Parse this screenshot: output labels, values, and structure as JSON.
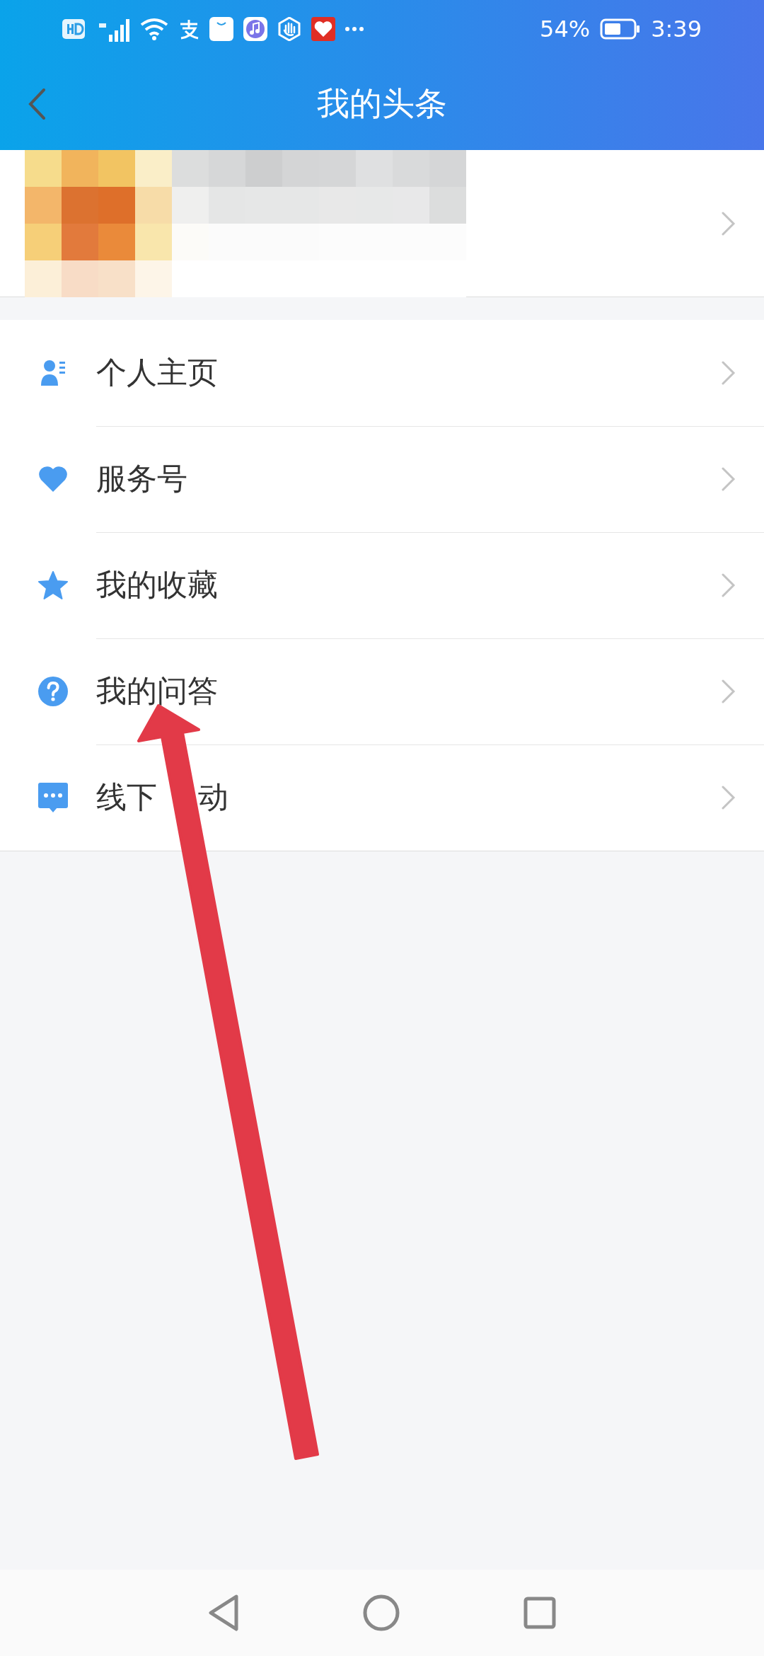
{
  "status_bar": {
    "battery_percent": "54%",
    "time": "3:39"
  },
  "header": {
    "title": "我的头条"
  },
  "menu": [
    {
      "label": "个人主页"
    },
    {
      "label": "服务号"
    },
    {
      "label": "我的收藏"
    },
    {
      "label": "我的问答"
    },
    {
      "label": "线下",
      "label_continued": "动"
    }
  ]
}
